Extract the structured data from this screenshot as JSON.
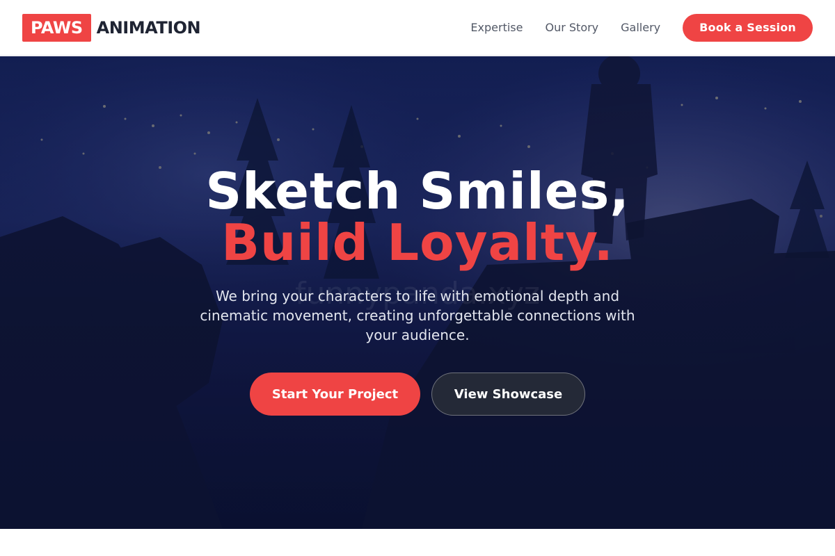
{
  "header": {
    "logo_box": "PAWS",
    "logo_word": "ANIMATION",
    "nav": [
      {
        "label": "Expertise"
      },
      {
        "label": "Our Story"
      },
      {
        "label": "Gallery"
      }
    ],
    "cta_label": "Book a Session"
  },
  "hero": {
    "headline": "Sketch Smiles,",
    "headline_accent": "Build Loyalty.",
    "subtitle": "We bring your characters to life with emotional depth and cinematic movement, creating unforgettable connections with your audience.",
    "primary_cta": "Start Your Project",
    "secondary_cta": "View Showcase",
    "watermark": "funnypanda.xyz"
  },
  "colors": {
    "accent": "#ef4444",
    "header_text": "#1f2433",
    "nav_text": "#525866",
    "hero_overlay": "#0c1233"
  }
}
